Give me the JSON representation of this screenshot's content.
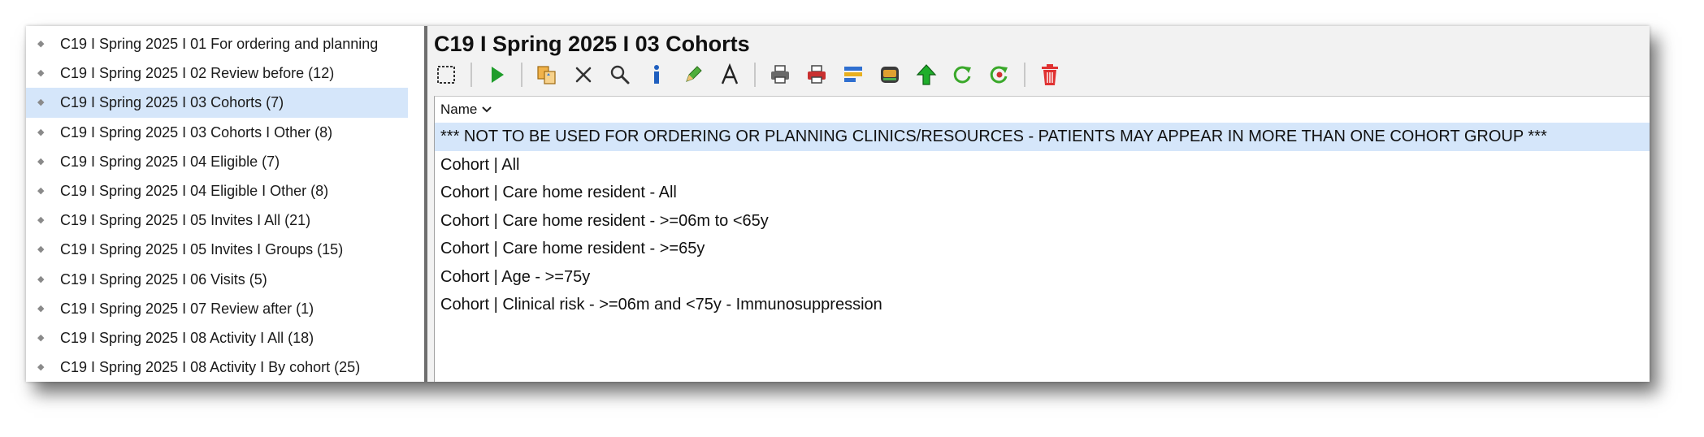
{
  "tree": {
    "items": [
      {
        "label": "C19 I Spring 2025 I 01 For ordering and planning",
        "selected": false
      },
      {
        "label": "C19 I Spring 2025 I 02 Review before (12)",
        "selected": false
      },
      {
        "label": "C19 I Spring 2025 I 03 Cohorts (7)",
        "selected": true
      },
      {
        "label": "C19 I Spring 2025 I 03 Cohorts I Other (8)",
        "selected": false
      },
      {
        "label": "C19 I Spring 2025 I 04 Eligible (7)",
        "selected": false
      },
      {
        "label": "C19 I Spring 2025 I 04 Eligible I Other (8)",
        "selected": false
      },
      {
        "label": "C19 I Spring 2025 I 05 Invites I All (21)",
        "selected": false
      },
      {
        "label": "C19 I Spring 2025 I 05 Invites I Groups (15)",
        "selected": false
      },
      {
        "label": "C19 I Spring 2025 I 06 Visits (5)",
        "selected": false
      },
      {
        "label": "C19 I Spring 2025 I 07 Review after (1)",
        "selected": false
      },
      {
        "label": "C19 I Spring 2025 I 08 Activity I All (18)",
        "selected": false
      },
      {
        "label": "C19 I Spring 2025 I 08 Activity I By cohort (25)",
        "selected": false
      }
    ]
  },
  "main": {
    "title": "C19 I Spring 2025 I 03 Cohorts",
    "column_header": "Name",
    "rows": [
      "*** NOT TO BE USED FOR ORDERING OR PLANNING CLINICS/RESOURCES - PATIENTS MAY APPEAR IN MORE THAN ONE COHORT GROUP ***",
      "Cohort |  All",
      "Cohort |  Care home resident -  All",
      "Cohort |  Care home resident - >=06m to <65y",
      "Cohort |  Care home resident - >=65y",
      "Cohort | Age - >=75y",
      "Cohort | Clinical risk - >=06m and <75y - Immunosuppression"
    ]
  },
  "toolbar_icons": [
    "select-all-icon",
    "run-icon",
    "copy-icon",
    "delete-x-icon",
    "search-icon",
    "info-icon",
    "edit-icon",
    "rename-icon",
    "print-icon",
    "print-red-icon",
    "report-icon",
    "export-icon",
    "move-up-icon",
    "refresh-icon",
    "refresh-red-icon",
    "trash-icon"
  ],
  "colors": {
    "selection": "#d5e6fa",
    "run_green": "#1f9d2b",
    "delete_red": "#e03232"
  }
}
